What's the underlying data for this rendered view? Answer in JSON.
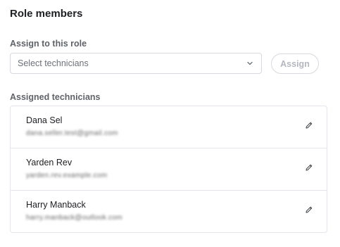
{
  "panel": {
    "title": "Role members"
  },
  "assign": {
    "label": "Assign to this role",
    "select_placeholder": "Select technicians",
    "button_label": "Assign"
  },
  "assigned": {
    "label": "Assigned technicians",
    "members": [
      {
        "name": "Dana Sel",
        "email": "dana.seller.test@gmail.com"
      },
      {
        "name": "Yarden Rev",
        "email": "yarden.rev.example.com"
      },
      {
        "name": "Harry Manback",
        "email": "harry.manback@outlook.com"
      }
    ]
  },
  "icons": {
    "select": "chevron-down-icon",
    "edit": "pencil-icon"
  },
  "colors": {
    "text_primary": "#202124",
    "text_secondary": "#5f6368",
    "border": "#d6d9de",
    "disabled_text": "#b3b8bf"
  }
}
